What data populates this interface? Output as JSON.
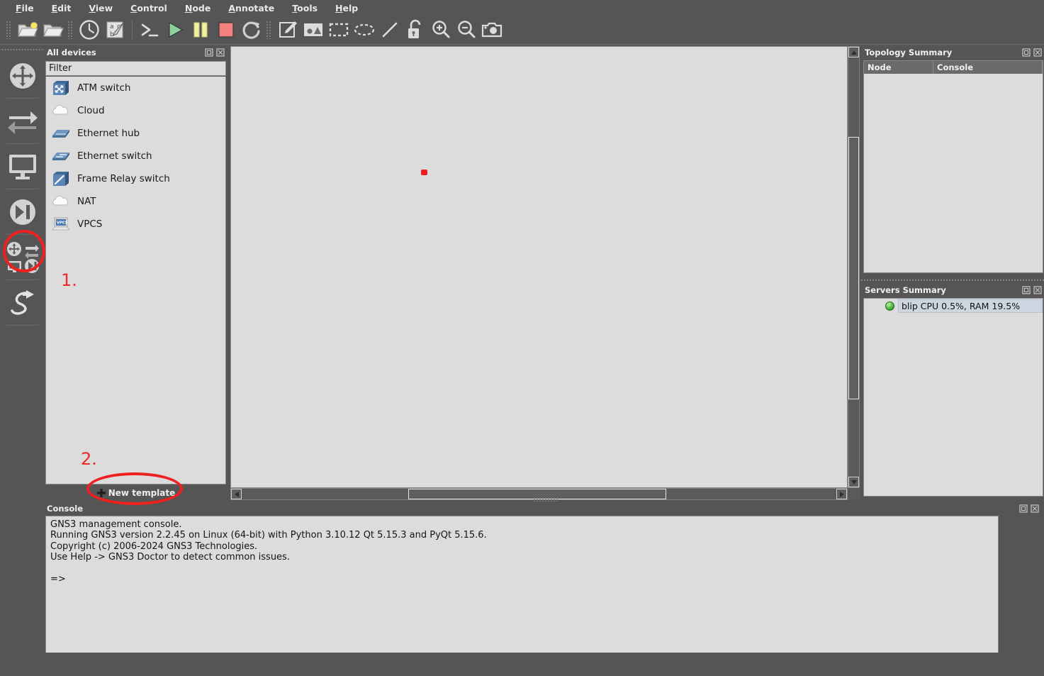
{
  "app": {
    "title": "GNS3"
  },
  "menubar": {
    "items": [
      {
        "label": "File",
        "mnemonic": "F"
      },
      {
        "label": "Edit",
        "mnemonic": "E"
      },
      {
        "label": "View",
        "mnemonic": "V"
      },
      {
        "label": "Control",
        "mnemonic": "C"
      },
      {
        "label": "Node",
        "mnemonic": "N"
      },
      {
        "label": "Annotate",
        "mnemonic": "A"
      },
      {
        "label": "Tools",
        "mnemonic": "T"
      },
      {
        "label": "Help",
        "mnemonic": "H"
      }
    ]
  },
  "toolbar": {
    "buttons": [
      {
        "name": "new-project-icon",
        "tooltip": "New project"
      },
      {
        "name": "open-project-icon",
        "tooltip": "Open project"
      },
      {
        "name": "recent-projects-icon",
        "tooltip": "Recent projects"
      },
      {
        "name": "edit-project-icon",
        "tooltip": "Edit project"
      },
      {
        "name": "console-all-icon",
        "tooltip": "Console connect to all nodes"
      },
      {
        "name": "start-all-icon",
        "tooltip": "Start all nodes"
      },
      {
        "name": "suspend-all-icon",
        "tooltip": "Suspend all nodes"
      },
      {
        "name": "stop-all-icon",
        "tooltip": "Stop all nodes"
      },
      {
        "name": "reload-all-icon",
        "tooltip": "Reload all nodes"
      },
      {
        "name": "add-note-icon",
        "tooltip": "Add a note"
      },
      {
        "name": "insert-image-icon",
        "tooltip": "Insert a picture"
      },
      {
        "name": "draw-rectangle-icon",
        "tooltip": "Draw a rectangle"
      },
      {
        "name": "draw-ellipse-icon",
        "tooltip": "Draw an ellipse"
      },
      {
        "name": "draw-line-icon",
        "tooltip": "Draw a line"
      },
      {
        "name": "lock-items-icon",
        "tooltip": "Lock or unlock all items"
      },
      {
        "name": "zoom-in-icon",
        "tooltip": "Zoom in"
      },
      {
        "name": "zoom-out-icon",
        "tooltip": "Zoom out"
      },
      {
        "name": "screenshot-icon",
        "tooltip": "Take a screenshot"
      }
    ]
  },
  "left_toolbar": {
    "buttons": [
      {
        "name": "browse-routers-icon",
        "label": "Browse Routers"
      },
      {
        "name": "browse-switches-icon",
        "label": "Browse Switches"
      },
      {
        "name": "browse-end-devices-icon",
        "label": "Browse End Devices"
      },
      {
        "name": "browse-security-devices-icon",
        "label": "Browse Security Devices"
      },
      {
        "name": "browse-all-devices-icon",
        "label": "Browse All Devices"
      },
      {
        "name": "add-link-icon",
        "label": "Add a Link"
      }
    ]
  },
  "devices_dock": {
    "title": "All devices",
    "filter": {
      "placeholder": "Filter",
      "value": ""
    },
    "items": [
      {
        "label": "ATM switch",
        "icon": "atm-switch-icon"
      },
      {
        "label": "Cloud",
        "icon": "cloud-icon"
      },
      {
        "label": "Ethernet hub",
        "icon": "ethernet-hub-icon"
      },
      {
        "label": "Ethernet switch",
        "icon": "ethernet-switch-icon"
      },
      {
        "label": "Frame Relay switch",
        "icon": "frame-relay-switch-icon"
      },
      {
        "label": "NAT",
        "icon": "nat-icon"
      },
      {
        "label": "VPCS",
        "icon": "vpcs-icon"
      }
    ],
    "new_template_label": "New template"
  },
  "topology_dock": {
    "title": "Topology Summary",
    "columns": [
      "Node",
      "Console"
    ],
    "rows": []
  },
  "servers_dock": {
    "title": "Servers Summary",
    "rows": [
      {
        "status": "running",
        "text": "blip CPU 0.5%, RAM 19.5%"
      }
    ]
  },
  "console_dock": {
    "title": "Console",
    "lines": [
      "GNS3 management console.",
      "Running GNS3 version 2.2.45 on Linux (64-bit) with Python 3.10.12 Qt 5.15.3 and PyQt 5.15.6.",
      "Copyright (c) 2006-2024 GNS3 Technologies.",
      "Use Help -> GNS3 Doctor to detect common issues.",
      "",
      "=>"
    ]
  },
  "annotations": [
    {
      "label": "1.",
      "target": "browse-all-devices-icon"
    },
    {
      "label": "2.",
      "target": "new-template-button"
    }
  ],
  "colors": {
    "chrome": "#555555",
    "panel": "#dcdcdc",
    "annotation_red": "#ee2020",
    "start_green": "#8fcf9a",
    "suspend_yellow": "#f2f0a0",
    "stop_red": "#f4807c",
    "device_blue": "#5a7fa8"
  }
}
